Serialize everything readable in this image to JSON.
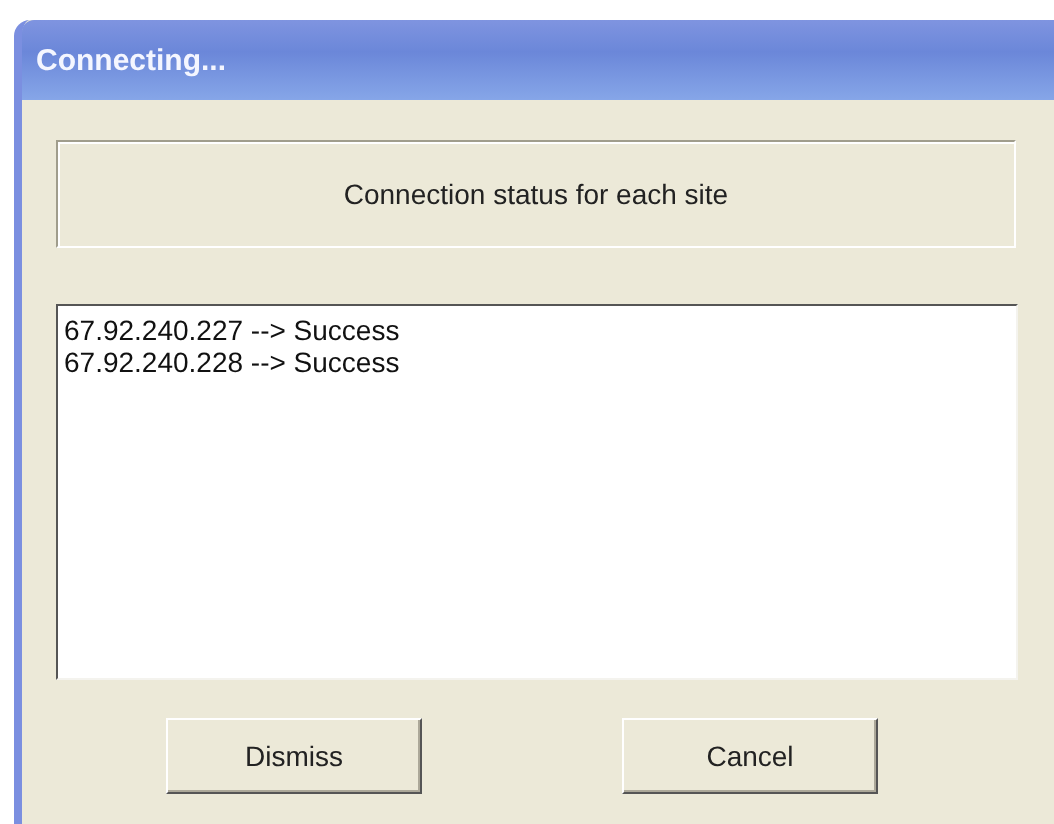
{
  "window": {
    "title": "Connecting..."
  },
  "header": {
    "text": "Connection status for each site"
  },
  "results": [
    "67.92.240.227 --> Success",
    "67.92.240.228 --> Success"
  ],
  "buttons": [
    "Dismiss",
    "Cancel"
  ]
}
